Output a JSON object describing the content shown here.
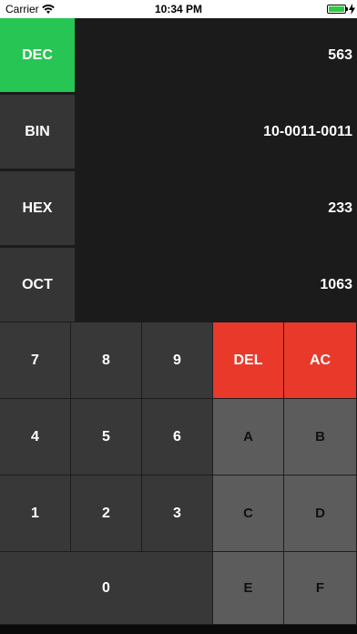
{
  "status_bar": {
    "carrier": "Carrier",
    "time": "10:34 PM",
    "battery_level": 1.0
  },
  "bases": [
    {
      "label": "DEC",
      "value": "563",
      "active": true
    },
    {
      "label": "BIN",
      "value": "10-0011-0011",
      "active": false
    },
    {
      "label": "HEX",
      "value": "233",
      "active": false
    },
    {
      "label": "OCT",
      "value": "1063",
      "active": false
    }
  ],
  "keypad": {
    "k7": "7",
    "k8": "8",
    "k9": "9",
    "del": "DEL",
    "ac": "AC",
    "k4": "4",
    "k5": "5",
    "k6": "6",
    "a": "A",
    "b": "B",
    "k1": "1",
    "k2": "2",
    "k3": "3",
    "c": "C",
    "d": "D",
    "k0": "0",
    "e": "E",
    "f": "F"
  },
  "colors": {
    "active_base": "#27c553",
    "operator": "#e8392b",
    "digit_key": "#383838",
    "hex_key": "#5c5c5c",
    "display_bg": "#1b1b1b"
  }
}
